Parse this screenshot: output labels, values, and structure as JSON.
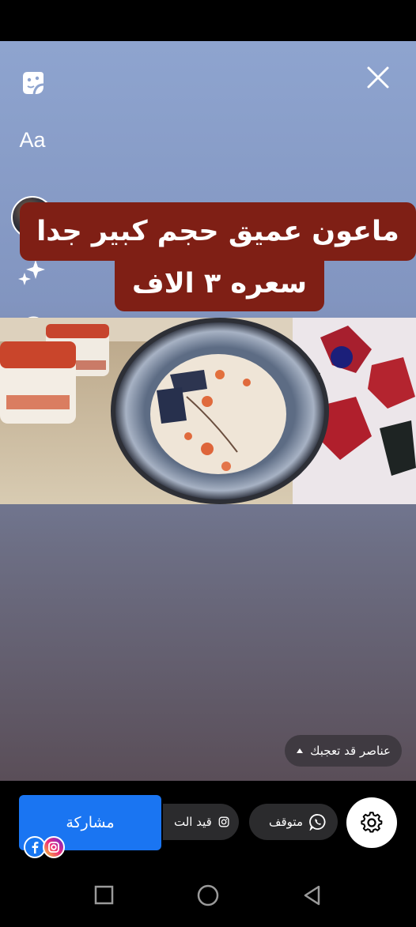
{
  "story": {
    "tools": {
      "text_label": "Aa",
      "mention_label": "@"
    },
    "caption": {
      "line1": "ماعون عميق حجم كبير جدا",
      "line2": "سعره ٣ الاف"
    },
    "photo_description_icon": "photo",
    "suggestion_label": "عناصر قد تعجبك"
  },
  "bottom_bar": {
    "share_label": "مشاركة",
    "whatsapp_status": "متوقف",
    "instagram_status": "قيد الت",
    "settings_icon": "gear-icon"
  },
  "colors": {
    "accent_blue": "#1a75f2",
    "caption_bg": "#7f1f15"
  }
}
